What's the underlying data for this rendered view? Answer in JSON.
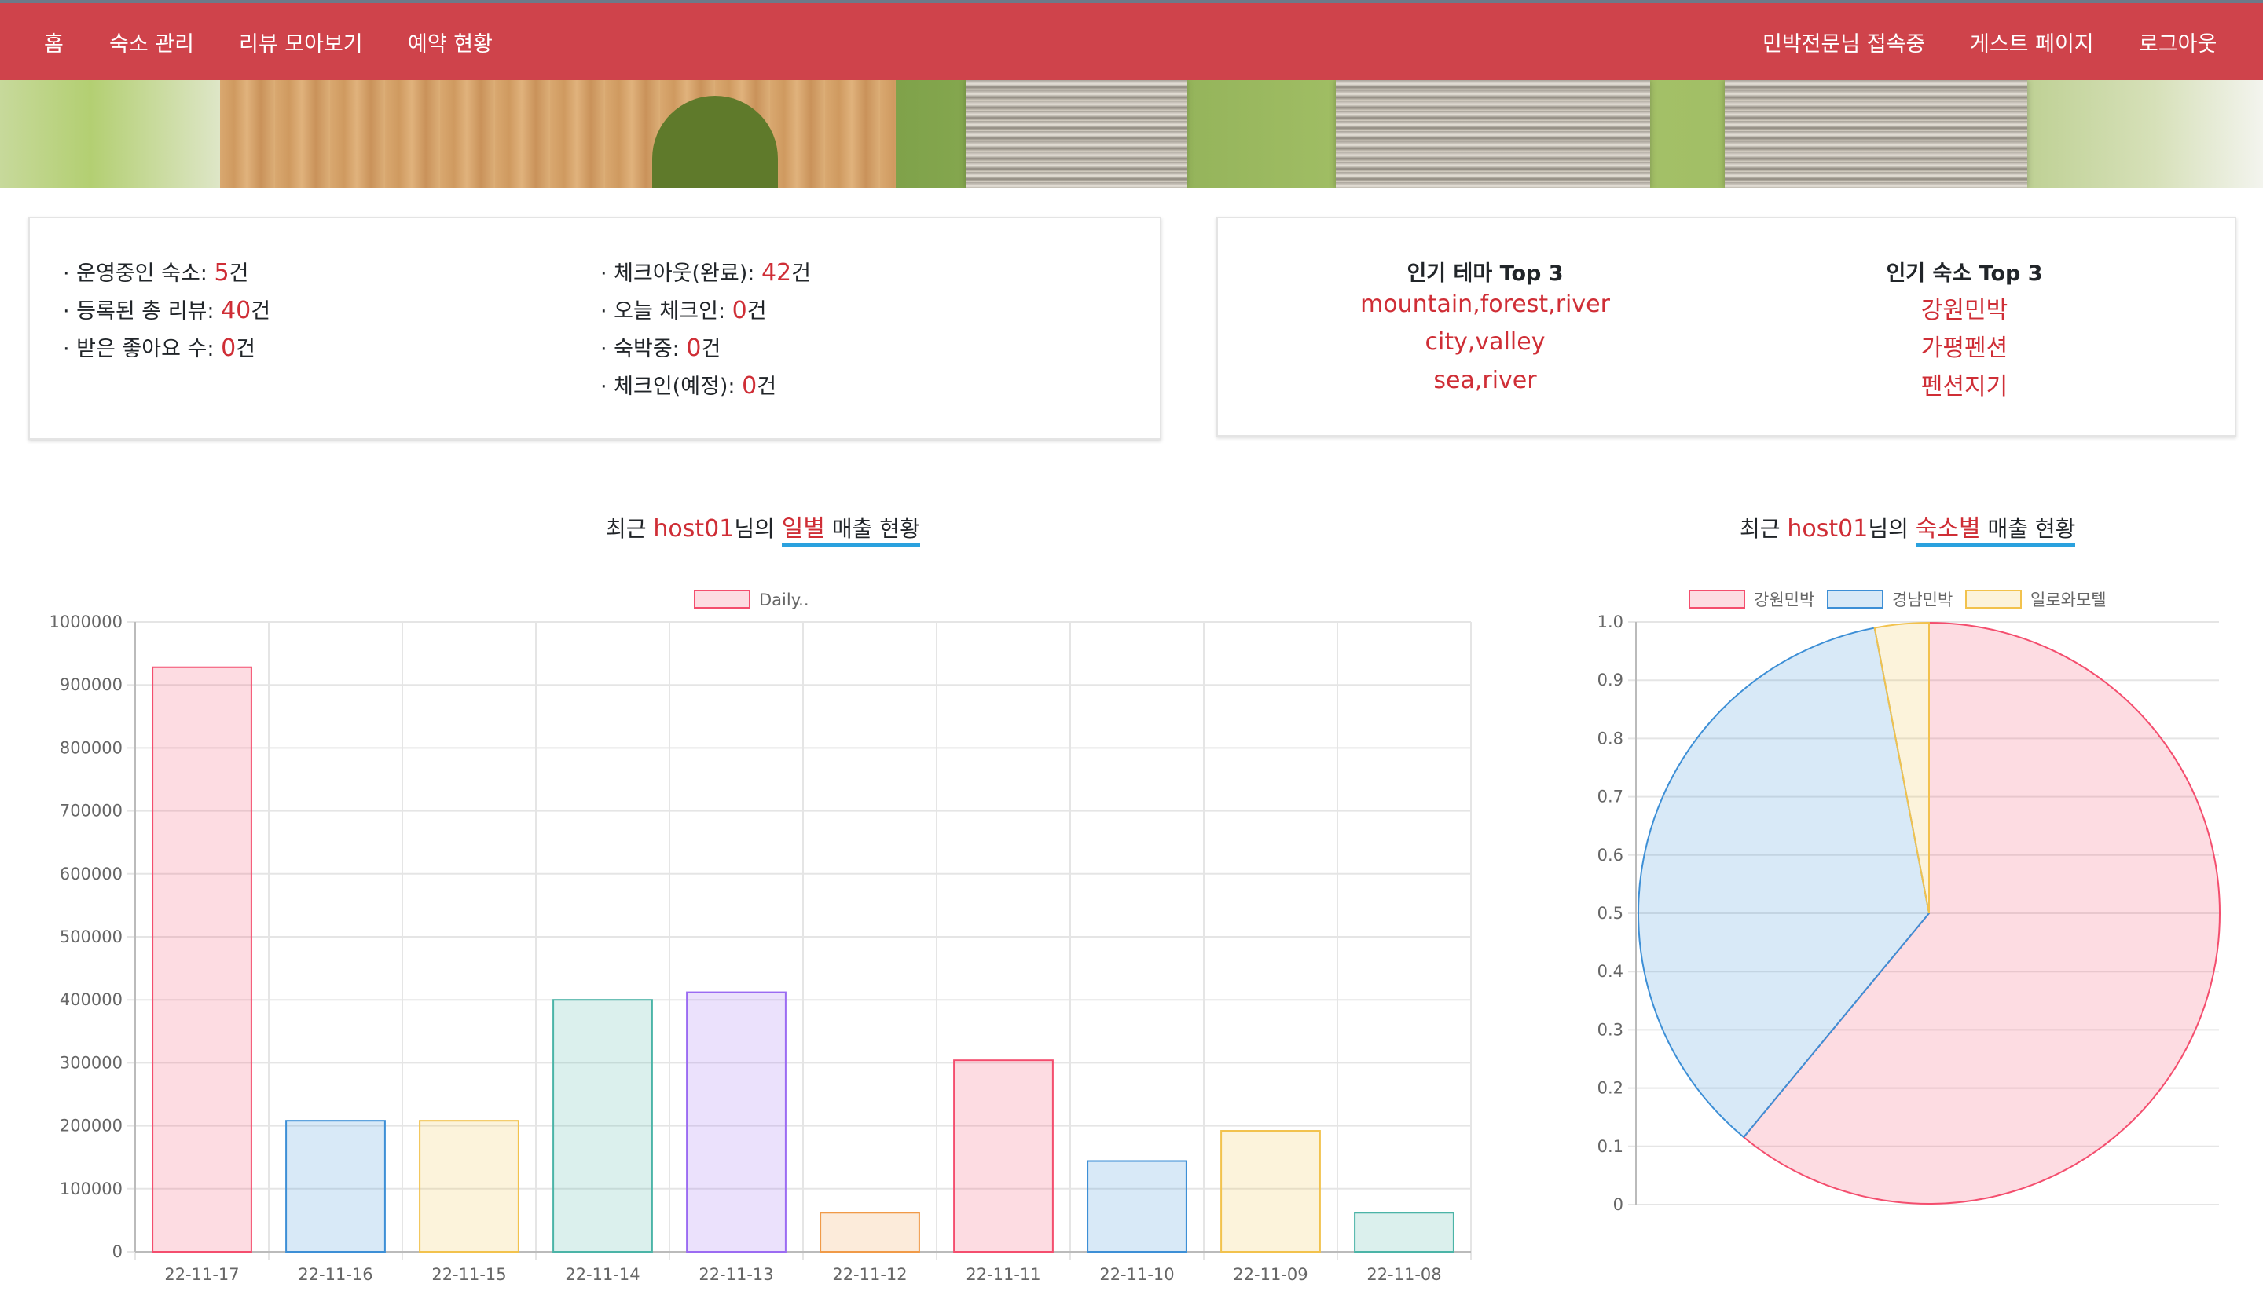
{
  "nav": {
    "left": [
      "홈",
      "숙소 관리",
      "리뷰 모아보기",
      "예약 현황"
    ],
    "right": [
      "민박전문님 접속중",
      "게스트 페이지",
      "로그아웃"
    ],
    "color": "#cf434b"
  },
  "stats": {
    "left": [
      {
        "label": "· 운영중인 숙소: ",
        "value": "5",
        "unit": "건"
      },
      {
        "label": "· 등록된 총 리뷰: ",
        "value": "40",
        "unit": "건"
      },
      {
        "label": "· 받은 좋아요 수: ",
        "value": "0",
        "unit": "건"
      }
    ],
    "right": [
      {
        "label": "· 체크아웃(완료): ",
        "value": "42",
        "unit": "건"
      },
      {
        "label": "· 오늘 체크인: ",
        "value": "0",
        "unit": "건"
      },
      {
        "label": "· 숙박중: ",
        "value": "0",
        "unit": "건"
      },
      {
        "label": "· 체크인(예정): ",
        "value": "0",
        "unit": "건"
      }
    ]
  },
  "popular": {
    "theme_title": "인기 테마 Top 3",
    "themes": [
      "mountain,forest,river",
      "city,valley",
      "sea,river"
    ],
    "lodging_title": "인기 숙소 Top 3",
    "lodgings": [
      "강원민박",
      "가평펜션",
      "펜션지기"
    ]
  },
  "daily_title": {
    "p1": "최근 ",
    "host": "host01",
    "p2": "님의 ",
    "kw": "일별",
    "p3": " 매출 현황"
  },
  "lodging_title": {
    "p1": "최근 ",
    "host": "host01",
    "p2": "님의 ",
    "kw": "숙소별",
    "p3": " 매출 현황"
  },
  "chart_data": [
    {
      "type": "bar",
      "categories": [
        "22-11-17",
        "22-11-16",
        "22-11-15",
        "22-11-14",
        "22-11-13",
        "22-11-12",
        "22-11-11",
        "22-11-10",
        "22-11-09",
        "22-11-08"
      ],
      "series": [
        {
          "name": "Daily..",
          "values": [
            928000,
            208000,
            208000,
            400000,
            412000,
            62000,
            304000,
            144000,
            192000,
            62000
          ]
        }
      ],
      "ylim": [
        0,
        1000000
      ],
      "yticks": [
        "0",
        "100000",
        "200000",
        "300000",
        "400000",
        "500000",
        "600000",
        "700000",
        "800000",
        "900000",
        "1000000"
      ],
      "legend": "top",
      "grid": true,
      "colors": [
        "#f44e6e",
        "#3d8fd6",
        "#f2c24d",
        "#4bb4a7",
        "#9b6bf2",
        "#f09a48",
        "#f44e6e",
        "#3d8fd6",
        "#f2c24d",
        "#4bb4a7"
      ]
    },
    {
      "type": "pie",
      "labels": [
        "강원민박",
        "경남민박",
        "일로와모텔"
      ],
      "values": [
        61,
        36,
        3
      ],
      "yticks": [
        "0",
        "0.1",
        "0.2",
        "0.3",
        "0.4",
        "0.5",
        "0.6",
        "0.7",
        "0.8",
        "0.9",
        "1.0"
      ],
      "legend": "top",
      "grid": true,
      "colors": [
        "#f44e6e",
        "#3d8fd6",
        "#f2c24d"
      ]
    }
  ]
}
